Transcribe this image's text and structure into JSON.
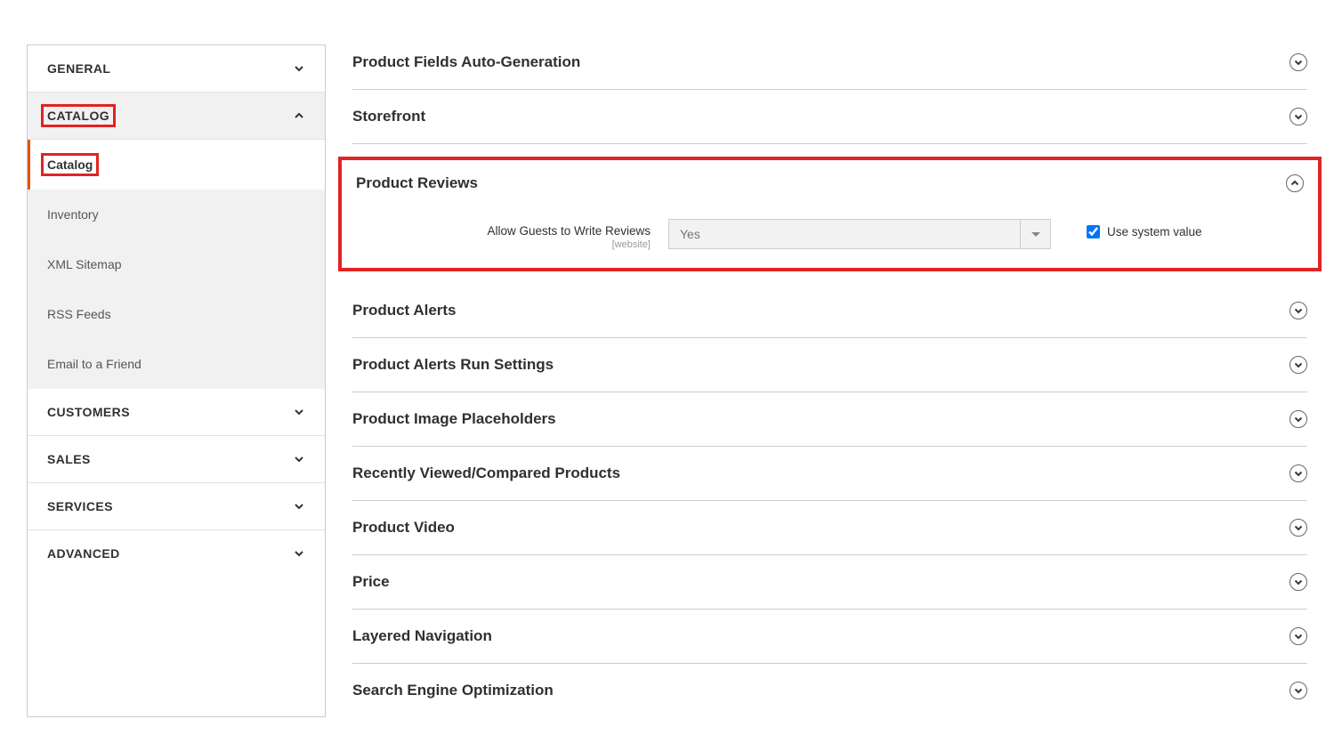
{
  "sidebar": {
    "general": "GENERAL",
    "catalog": "CATALOG",
    "sub": {
      "catalog": "Catalog",
      "inventory": "Inventory",
      "xml": "XML Sitemap",
      "rss": "RSS Feeds",
      "email": "Email to a Friend"
    },
    "customers": "CUSTOMERS",
    "sales": "SALES",
    "services": "SERVICES",
    "advanced": "ADVANCED"
  },
  "sections": {
    "autogen": "Product Fields Auto-Generation",
    "storefront": "Storefront",
    "reviews": "Product Reviews",
    "alerts": "Product Alerts",
    "alerts_run": "Product Alerts Run Settings",
    "placeholders": "Product Image Placeholders",
    "recently": "Recently Viewed/Compared Products",
    "video": "Product Video",
    "price": "Price",
    "layered": "Layered Navigation",
    "seo": "Search Engine Optimization"
  },
  "field": {
    "label": "Allow Guests to Write Reviews",
    "scope": "[website]",
    "value": "Yes",
    "use_system": "Use system value"
  }
}
